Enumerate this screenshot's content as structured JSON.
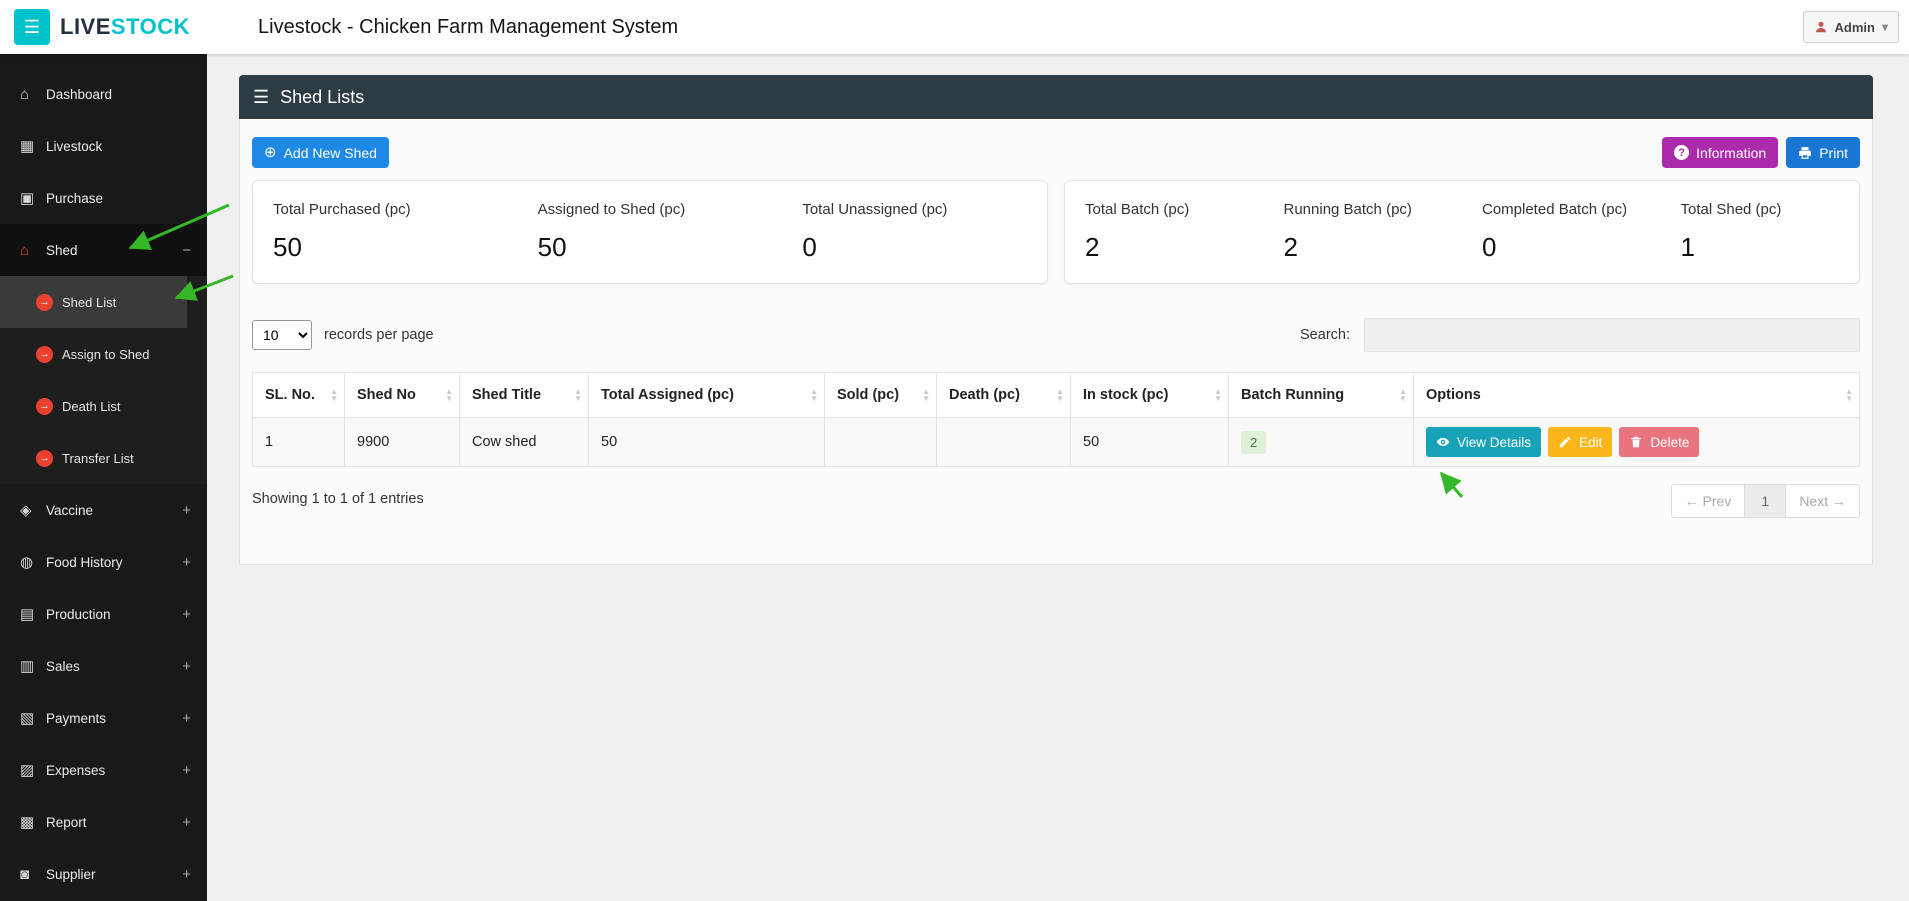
{
  "topbar": {
    "logo_live": "LIVE",
    "logo_stock": "STOCK",
    "title": "Livestock - Chicken Farm Management System",
    "admin": {
      "label": "Admin"
    }
  },
  "icons": {
    "hamburger": "☰",
    "panel_menu": "☰",
    "plus_circle": "⊕",
    "question": "?",
    "caret_down": "▾"
  },
  "sidebar": {
    "items": [
      {
        "label": "Dashboard",
        "icon": "dashboard-icon",
        "glyph": "⌂",
        "toggle": ""
      },
      {
        "label": "Livestock",
        "icon": "livestock-icon",
        "glyph": "▦",
        "toggle": ""
      },
      {
        "label": "Purchase",
        "icon": "purchase-icon",
        "glyph": "▣",
        "toggle": ""
      },
      {
        "label": "Shed",
        "icon": "shed-icon",
        "glyph": "⌂",
        "toggle": "−"
      },
      {
        "label": "Vaccine",
        "icon": "vaccine-icon",
        "glyph": "◈",
        "toggle": "+"
      },
      {
        "label": "Food History",
        "icon": "food-history-icon",
        "glyph": "◍",
        "toggle": "+"
      },
      {
        "label": "Production",
        "icon": "production-icon",
        "glyph": "▤",
        "toggle": "+"
      },
      {
        "label": "Sales",
        "icon": "sales-icon",
        "glyph": "▥",
        "toggle": "+"
      },
      {
        "label": "Payments",
        "icon": "payments-icon",
        "glyph": "▧",
        "toggle": "+"
      },
      {
        "label": "Expenses",
        "icon": "expenses-icon",
        "glyph": "▨",
        "toggle": "+"
      },
      {
        "label": "Report",
        "icon": "report-icon",
        "glyph": "▩",
        "toggle": "+"
      },
      {
        "label": "Supplier",
        "icon": "supplier-icon",
        "glyph": "◙",
        "toggle": "+"
      }
    ],
    "shed_submenu": [
      {
        "label": "Shed List",
        "glyph": "→"
      },
      {
        "label": "Assign to Shed",
        "glyph": "→"
      },
      {
        "label": "Death List",
        "glyph": "→"
      },
      {
        "label": "Transfer List",
        "glyph": "→"
      }
    ]
  },
  "panel": {
    "title": "Shed Lists",
    "buttons": {
      "add": "Add New Shed",
      "information": "Information",
      "print": "Print"
    }
  },
  "stats_left": [
    {
      "label": "Total Purchased (pc)",
      "value": "50"
    },
    {
      "label": "Assigned to Shed (pc)",
      "value": "50"
    },
    {
      "label": "Total Unassigned (pc)",
      "value": "0"
    }
  ],
  "stats_right": [
    {
      "label": "Total Batch (pc)",
      "value": "2"
    },
    {
      "label": "Running Batch (pc)",
      "value": "2"
    },
    {
      "label": "Completed Batch (pc)",
      "value": "0"
    },
    {
      "label": "Total Shed (pc)",
      "value": "1"
    }
  ],
  "controls": {
    "page_size": "10",
    "records_label": "records per page",
    "search_label": "Search:"
  },
  "table": {
    "headers": [
      "SL. No.",
      "Shed No",
      "Shed Title",
      "Total Assigned (pc)",
      "Sold (pc)",
      "Death (pc)",
      "In stock (pc)",
      "Batch Running",
      "Options"
    ],
    "row": {
      "sl_no": "1",
      "shed_no": "9900",
      "shed_title": "Cow shed",
      "total_assigned": "50",
      "sold": "",
      "death": "",
      "in_stock": "50",
      "batch_running": "2"
    },
    "actions": {
      "view": "View Details",
      "edit": "Edit",
      "delete": "Delete"
    }
  },
  "footer": {
    "showing": "Showing 1 to 1 of 1 entries",
    "prev": "← Prev",
    "page": "1",
    "next": "Next →"
  },
  "colors": {
    "teal_accent": "#00c2cb",
    "sidebar_dark": "#191919",
    "panel_header_dark": "#2d3c42",
    "primary_blue": "#1e88e5",
    "information_purple": "#ab2bab",
    "print_blue": "#1976d2",
    "view_teal": "#17a2b8",
    "edit_yellow": "#fcb61a",
    "delete_red": "#e9737f",
    "badge_green_bg": "#dff0d8",
    "badge_green_text": "#3c763d",
    "annotation_green": "#35b729",
    "shed_icon_red": "#e8412f"
  }
}
